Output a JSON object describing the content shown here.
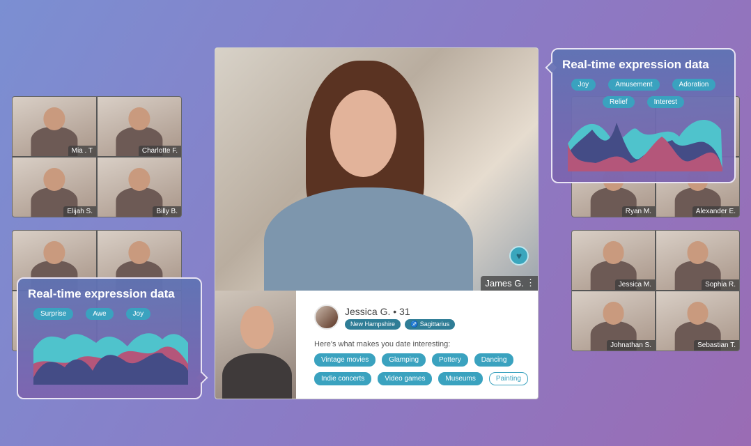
{
  "left_grid_top": [
    {
      "name": "Mia . T"
    },
    {
      "name": "Charlotte F."
    },
    {
      "name": "Elijah S."
    },
    {
      "name": "Billy B."
    }
  ],
  "right_grid_top": [
    {
      "name": "Ryan M."
    },
    {
      "name": "Alexander E."
    }
  ],
  "right_grid_bottom": [
    {
      "name": "Jessica M."
    },
    {
      "name": "Sophia R."
    },
    {
      "name": "Johnathan S."
    },
    {
      "name": "Sebastian T."
    }
  ],
  "main_video": {
    "name": "James G.",
    "menu_icon": "kebab-icon",
    "reaction_icon": "heart-icon"
  },
  "profile": {
    "name": "Jessica G. • 31",
    "location": "New Hampshire",
    "zodiac": "Sagittarius",
    "zodiac_icon": "sagittarius-icon",
    "intro": "Here's what makes you date interesting:",
    "tags": [
      {
        "label": "Vintage movies",
        "selected": true
      },
      {
        "label": "Glamping",
        "selected": true
      },
      {
        "label": "Pottery",
        "selected": true
      },
      {
        "label": "Dancing",
        "selected": true
      },
      {
        "label": "Indie concerts",
        "selected": true
      },
      {
        "label": "Video games",
        "selected": true
      },
      {
        "label": "Museums",
        "selected": true
      },
      {
        "label": "Painting",
        "selected": false
      }
    ]
  },
  "popup_right": {
    "title": "Real-time expression data",
    "chips": [
      "Joy",
      "Amusement",
      "Adoration",
      "Relief",
      "Interest"
    ]
  },
  "popup_left": {
    "title": "Real-time expression data",
    "chips": [
      "Surprise",
      "Awe",
      "Joy"
    ]
  },
  "colors": {
    "teal": "#3aa2bf",
    "dark_teal": "#2f7d96",
    "navy_area": "#444c86",
    "pink_area": "#b4567a",
    "cyan_area": "#4fc3cc"
  }
}
